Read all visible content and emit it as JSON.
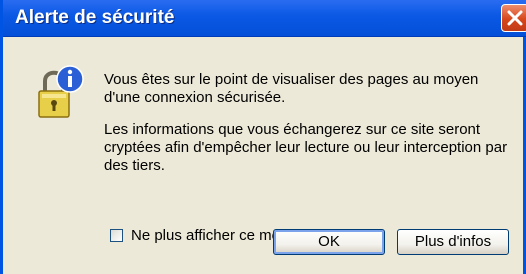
{
  "dialog": {
    "title": "Alerte de sécurité",
    "message_1": "Vous êtes sur le point de visualiser des pages au moyen d'une connexion sécurisée.",
    "message_2": "Les informations que vous échangerez sur ce site seront cryptées afin d'empêcher leur lecture ou leur interception par des tiers.",
    "checkbox_label": "Ne plus afficher ce message",
    "checkbox_checked": false,
    "ok_label": "OK",
    "info_label": "Plus d'infos",
    "icon": "lock-info-icon",
    "close_icon": "close-icon",
    "colors": {
      "titlebar": "#0a58e4",
      "close_button": "#d6471b",
      "background": "#ece9d8"
    }
  }
}
